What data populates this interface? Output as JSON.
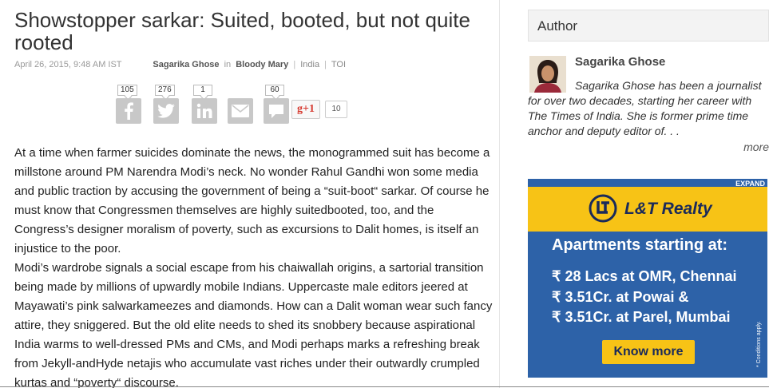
{
  "article": {
    "title": "Showstopper sarkar: Suited, booted, but not quite rooted",
    "date": "April 26, 2015, 9:48 AM IST",
    "author": "Sagarika Ghose",
    "in_label": "in",
    "blog": "Bloody Mary",
    "tags": [
      "India",
      "TOI"
    ],
    "paragraphs": [
      "At a time when farmer suicides dominate the news, the monogrammed suit has become a millstone around PM Narendra Modi’s neck. No wonder Rahul Gandhi won some media and public traction by accusing the government of being a “suit-boot“ sarkar. Of course he must know that Congressmen themselves are highly suitedbooted, too, and the Congress’s designer moralism of poverty, such as excursions to Dalit homes, is itself an injustice to the poor.",
      "Modi’s wardrobe signals a social escape from his chaiwallah origins, a sartorial transition being made by millions of upwardly mobile Indians. Uppercaste male editors jeered at Mayawati’s pink salwarkameezes and diamonds. How can a Dalit woman wear such fancy attire, they sniggered. But the old elite needs to shed its snobbery because aspirational India warms to well-dressed PMs and CMs, and Modi perhaps marks a refreshing break from Jekyll-andHyde netajis who accumulate vast riches under their outwardly crumpled kurtas and “poverty“ discourse."
    ]
  },
  "share": {
    "facebook_count": "105",
    "twitter_count": "276",
    "linkedin_count": "1",
    "comments_count": "60",
    "gplus_label": "g+1",
    "gplus_count": "10",
    "icons": [
      "facebook-icon",
      "twitter-icon",
      "linkedin-icon",
      "email-icon",
      "comment-icon"
    ]
  },
  "sidebar": {
    "author_heading": "Author",
    "author_name": "Sagarika Ghose",
    "author_bio_first": "Sagarika Ghose has been a journalist",
    "author_bio_rest": "for over two decades, starting her career with The Times of India. She is former prime time anchor and deputy editor of. . .",
    "more_label": "more"
  },
  "ad": {
    "expand_label": "EXPAND",
    "brand": "L&T Realty",
    "headline": "Apartments starting at:",
    "lines": [
      "₹ 28 Lacs at OMR, Chennai",
      "₹ 3.51Cr. at Powai &",
      "₹ 3.51Cr. at Parel, Mumbai"
    ],
    "cta": "Know more",
    "note": "* Conditions apply.",
    "colors": {
      "blue": "#2d62a8",
      "yellow": "#f7c316",
      "navy": "#1a2a5a"
    }
  }
}
